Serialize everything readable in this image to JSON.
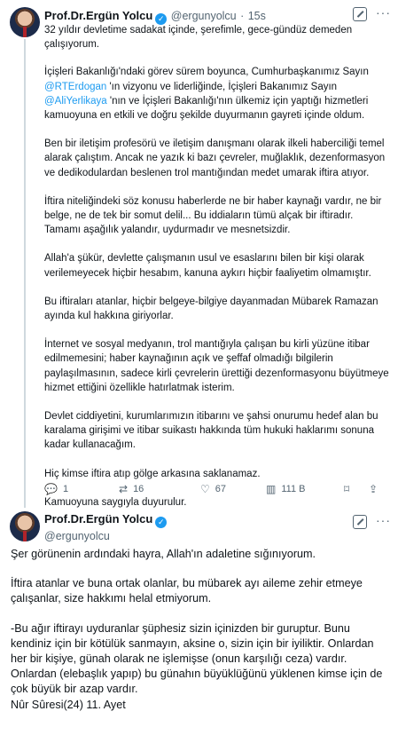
{
  "tweet1": {
    "author_name": "Prof.Dr.Ergün Yolcu",
    "handle": "@ergunyolcu",
    "separator": "·",
    "time": "15s",
    "line1": "32 yıldır devletime sadakat içinde, şerefimle, gece-gündüz demeden çalışıyorum.",
    "p2_a": "İçişleri Bakanlığı'ndaki görev sürem boyunca, Cumhurbaşkanımız Sayın ",
    "mention1": "@RTErdogan",
    "p2_b": " 'ın vizyonu ve liderliğinde, İçişleri Bakanımız Sayın ",
    "mention2": "@AliYerlikaya",
    "p2_c": " 'nın ve İçişleri Bakanlığı'nın ülkemiz için yaptığı hizmetleri kamuoyuna en etkili ve doğru şekilde duyurmanın gayreti içinde oldum.",
    "p3": "Ben bir iletişim profesörü ve iletişim danışmanı olarak ilkeli haberciliği temel alarak çalıştım. Ancak ne yazık ki bazı çevreler, muğlaklık, dezenformasyon ve dedikodulardan beslenen trol mantığından medet umarak iftira atıyor.",
    "p4": "İftira niteliğindeki söz konusu haberlerde ne bir haber kaynağı vardır, ne bir belge, ne de tek bir somut delil... Bu iddiaların tümü alçak bir iftiradır. Tamamı aşağılık yalandır, uydurmadır ve mesnetsizdir.",
    "p5": "Allah'a şükür, devlette çalışmanın usul ve esaslarını bilen bir kişi olarak verilemeyecek hiçbir hesabım, kanuna aykırı hiçbir faaliyetim olmamıştır.",
    "p6": "Bu iftiraları atanlar,  hiçbir belgeye-bilgiye dayanmadan Mübarek Ramazan ayında kul hakkına giriyorlar.",
    "p7": "İnternet ve sosyal medyanın, trol mantığıyla çalışan bu kirli yüzüne itibar edilmemesini; haber kaynağının açık ve şeffaf olmadığı bilgilerin paylaşılmasının, sadece kirli çevrelerin ürettiği dezenformasyonu büyütmeye hizmet ettiğini özellikle hatırlatmak isterim.",
    "p8": "Devlet ciddiyetini, kurumlarımızın itibarını ve şahsi onurumu hedef alan bu karalama girişimi ve itibar suikastı hakkında tüm hukuki haklarımı sonuna kadar kullanacağım.",
    "p9": "Hiç kimse iftira atıp gölge arkasına saklanamaz.",
    "p10": "Kamuoyuna saygıyla duyurulur.",
    "replies": "1",
    "retweets": "16",
    "likes": "67",
    "views": "111 B"
  },
  "tweet2": {
    "author_name": "Prof.Dr.Ergün Yolcu",
    "handle": "@ergunyolcu",
    "p1": "Şer görünenin ardındaki hayra, Allah'ın adaletine sığınıyorum.",
    "p2": "İftira atanlar ve buna ortak olanlar, bu mübarek ayı aileme zehir etmeye çalışanlar, size hakkımı helal etmiyorum.",
    "p3": "-Bu ağır iftirayı uyduranlar şüphesiz sizin içinizden bir guruptur. Bunu kendiniz için bir kötülük sanmayın, aksine o, sizin için bir iyiliktir. Onlardan her bir kişiye, günah olarak ne işlemişse (onun karşılığı ceza) vardır. Onlardan (elebaşlık yapıp) bu günahın büyüklüğünü yüklenen kimse için de çok büyük bir azap vardır.",
    "p4": "Nûr Sûresi(24) 11. Ayet"
  },
  "colors": {
    "accent": "#1d9bf0",
    "muted": "#536471",
    "text": "#0f1419"
  }
}
